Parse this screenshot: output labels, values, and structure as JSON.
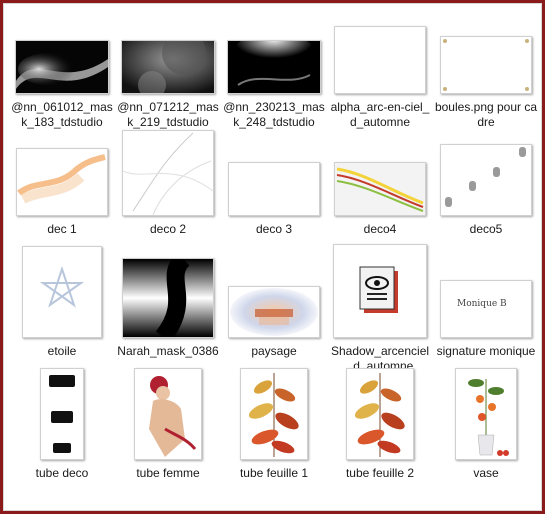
{
  "files": [
    {
      "name": "@nn_061012_mask_183_tdstudio"
    },
    {
      "name": "@nn_071212_mask_219_tdstudio"
    },
    {
      "name": "@nn_230213_mask_248_tdstudio"
    },
    {
      "name": "alpha_arc-en-ciel_d_automne"
    },
    {
      "name": "boules.png pour cadre"
    },
    {
      "name": "dec 1"
    },
    {
      "name": "deco 2"
    },
    {
      "name": "deco 3"
    },
    {
      "name": "deco4"
    },
    {
      "name": "deco5"
    },
    {
      "name": "etoile"
    },
    {
      "name": "Narah_mask_0386"
    },
    {
      "name": "paysage"
    },
    {
      "name": "Shadow_arcenciel_d_automne"
    },
    {
      "name": "signature monique",
      "thumb_text": "Monique B"
    },
    {
      "name": "tube deco"
    },
    {
      "name": "tube femme"
    },
    {
      "name": "tube feuille 1"
    },
    {
      "name": "tube feuille 2"
    },
    {
      "name": "vase"
    }
  ],
  "colors": {
    "frame": "#8b1a1a",
    "background": "#ffffff"
  }
}
